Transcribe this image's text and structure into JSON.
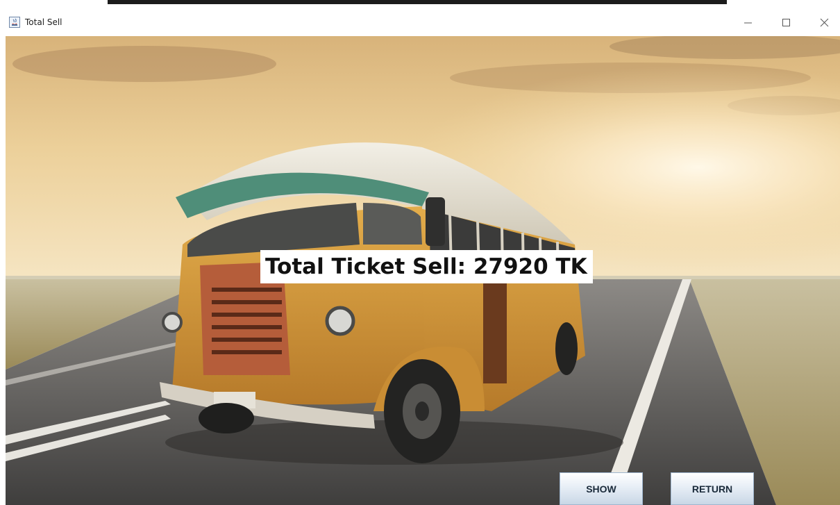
{
  "window": {
    "title": "Total Sell"
  },
  "controls": {
    "minimize": "minimize-icon",
    "maximize": "maximize-icon",
    "close": "close-icon"
  },
  "main": {
    "total_label": "Total Ticket Sell: 27920 TK",
    "show_label": "SHOW",
    "return_label": "RETURN"
  },
  "colors": {
    "sky": "#e9c98e",
    "road": "#5a5856",
    "bus_body": "#d9a23e",
    "bus_roof": "#e6e2d6",
    "visor": "#4f8e79",
    "button_border": "#9fb6cf"
  }
}
